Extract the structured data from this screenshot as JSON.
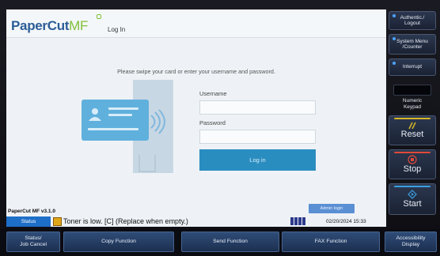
{
  "header": {
    "logo_text": "PaperCut",
    "logo_mf": "MF",
    "title": "Log In"
  },
  "login": {
    "prompt": "Please swipe your card or enter your username and password.",
    "username_label": "Username",
    "username_value": "",
    "password_label": "Password",
    "password_value": "",
    "login_button": "Log in"
  },
  "footer": {
    "version": "PaperCut MF v3.1.0",
    "admin_login": "Admin login",
    "status_label": "Status",
    "toner_message": "Toner is low. [C] (Replace when empty.)",
    "datetime": "02/20/2024  15:33"
  },
  "function_bar": {
    "status_job_cancel": "Status/\nJob Cancel",
    "copy": "Copy Function",
    "send": "Send Function",
    "fax": "FAX Function",
    "accessibility": "Accessibility\nDisplay"
  },
  "side_panel": {
    "auth_logout": "Authentic./\nLogout",
    "system_menu": "System Menu\n/Counter",
    "interrupt": "Interrupt",
    "numeric_keypad": "Numeric\nKeypad",
    "reset": "Reset",
    "stop": "Stop",
    "start": "Start"
  },
  "colors": {
    "accent_blue": "#2a8dc0",
    "card_blue": "#5fb0dd",
    "brand_green": "#7fbf3b",
    "brand_blue": "#2b5d97",
    "status_blue": "#1e6fc8",
    "reset_accent": "#d6b62a",
    "stop_accent": "#e04a3a",
    "start_accent": "#3aa0e0"
  },
  "icons": [
    "card-icon",
    "wireless-icon",
    "toner-icon",
    "memory-icon",
    "reset-icon",
    "stop-icon",
    "start-icon"
  ]
}
